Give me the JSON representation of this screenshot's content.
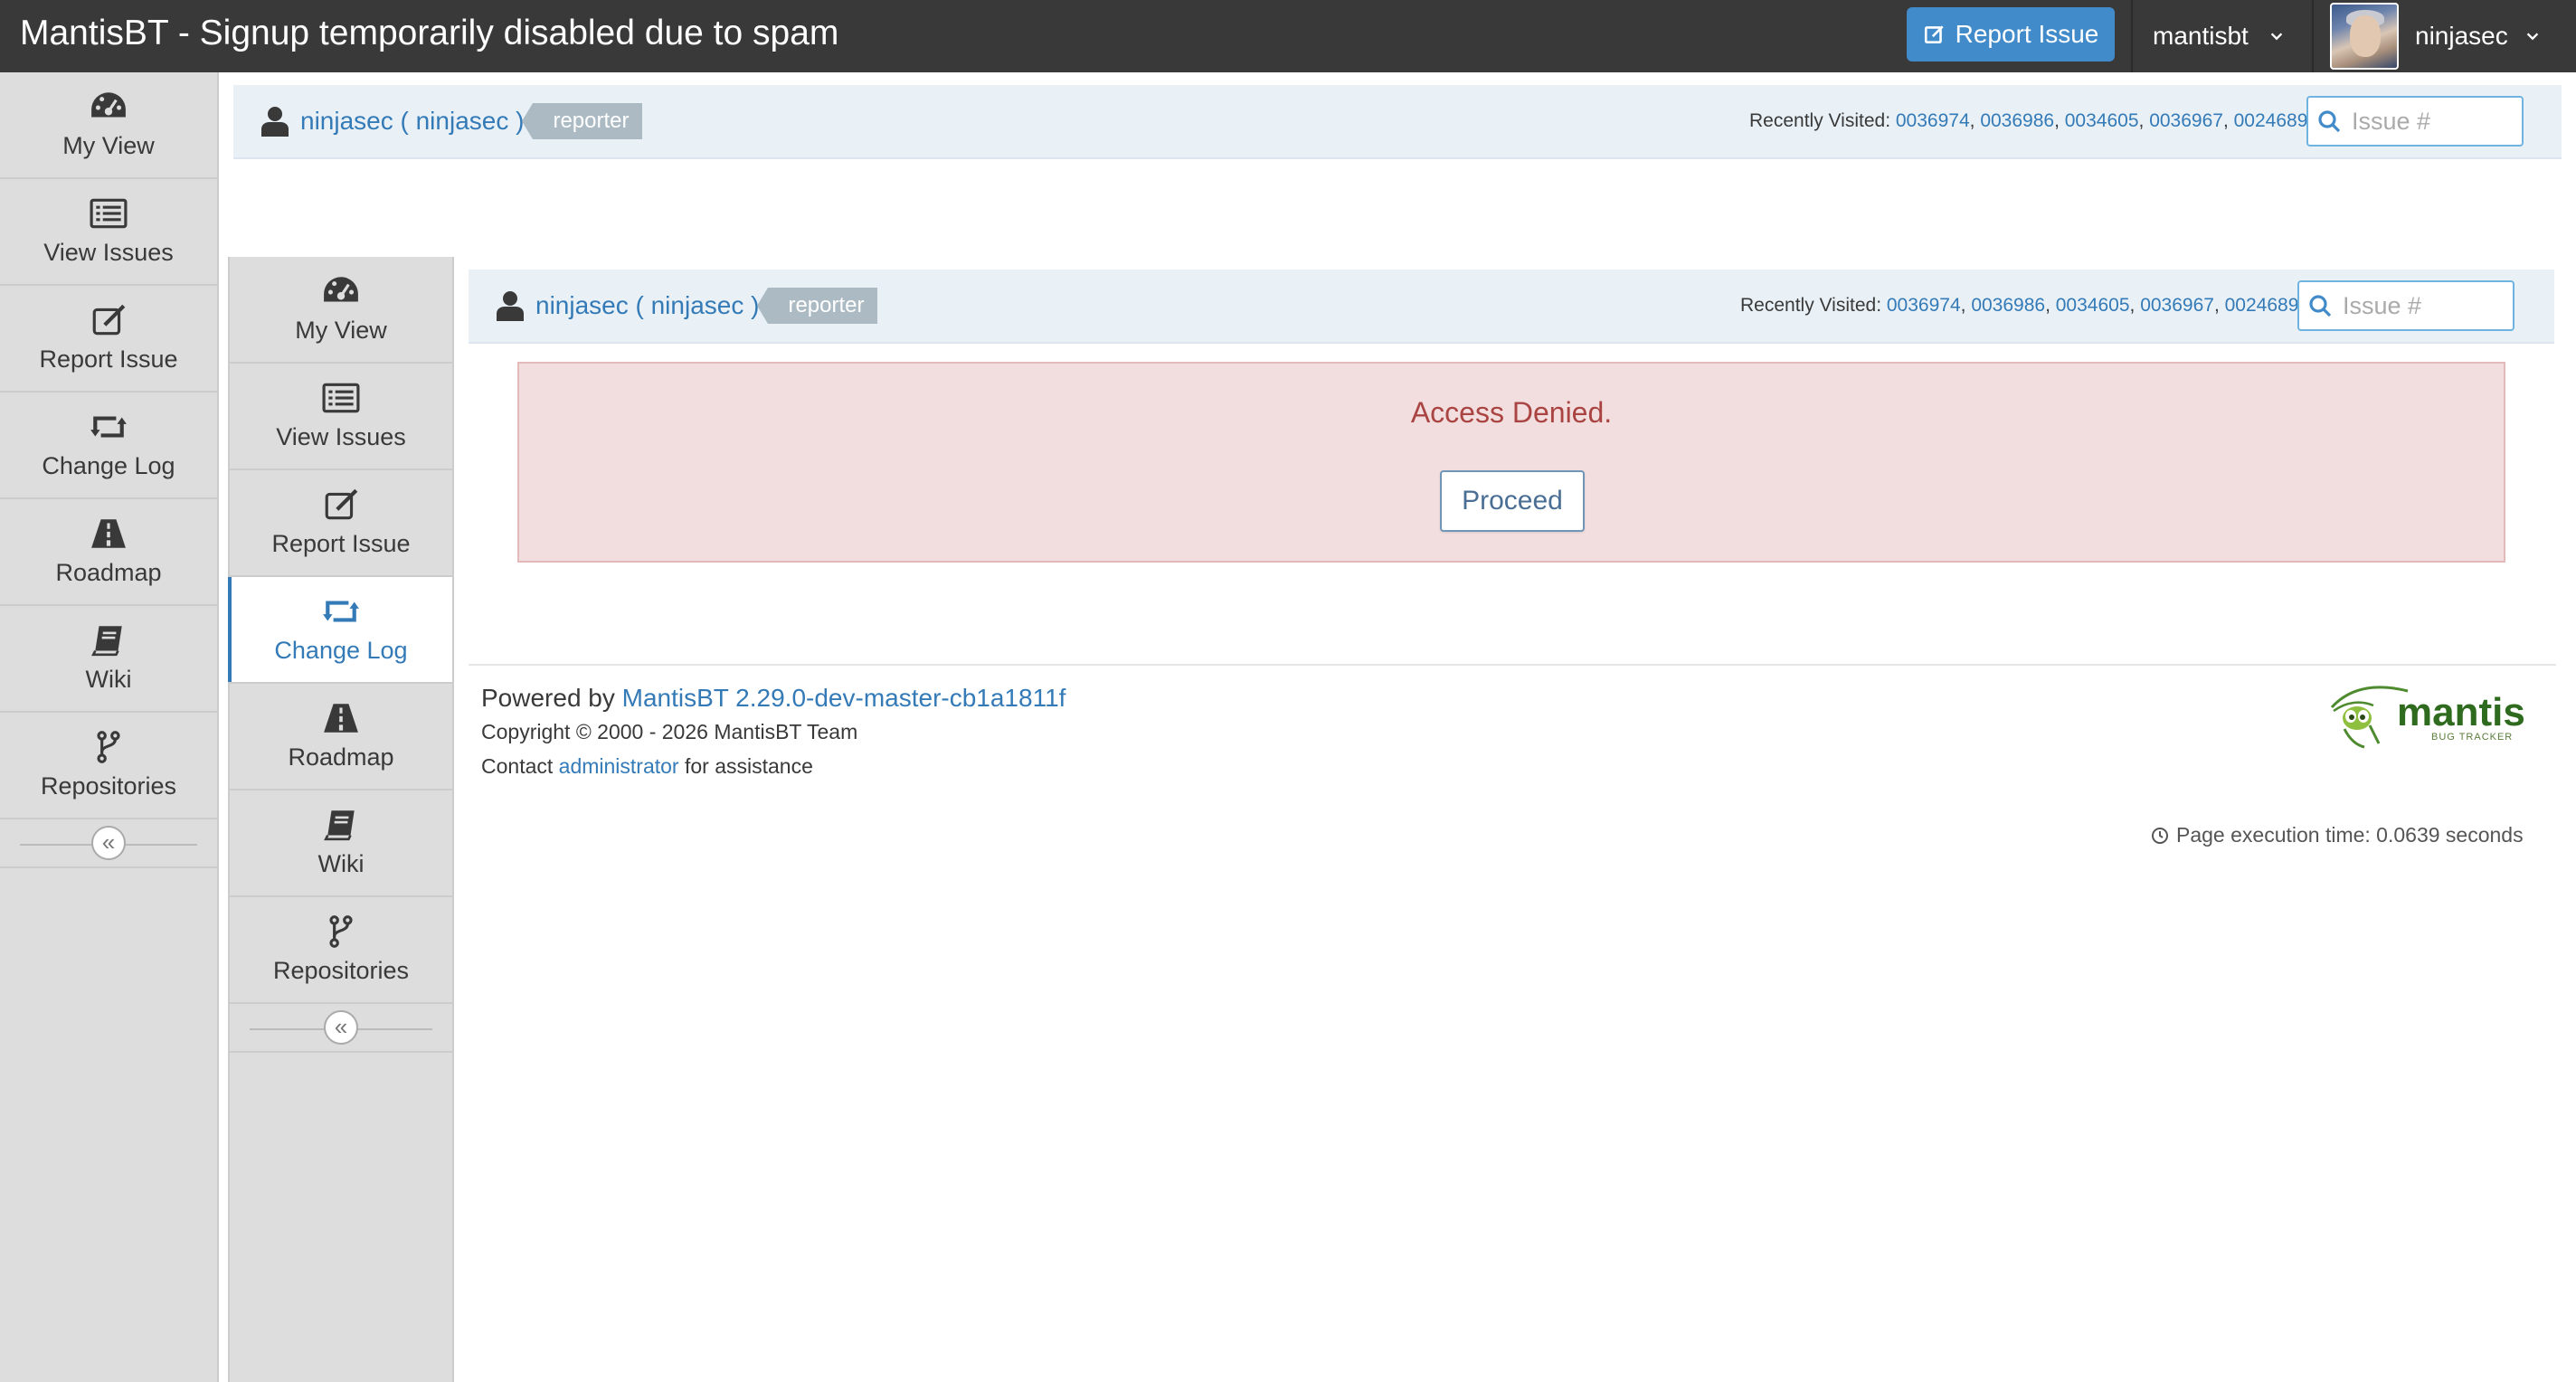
{
  "navbar": {
    "title": "MantisBT - Signup temporarily disabled due to spam",
    "report_label": "Report Issue",
    "project_label": "mantisbt",
    "user_label": "ninjasec"
  },
  "sidebar": {
    "items": [
      {
        "label": "My View",
        "icon": "dashboard-icon"
      },
      {
        "label": "View Issues",
        "icon": "list-icon"
      },
      {
        "label": "Report Issue",
        "icon": "edit-icon"
      },
      {
        "label": "Change Log",
        "icon": "retweet-icon"
      },
      {
        "label": "Roadmap",
        "icon": "road-icon"
      },
      {
        "label": "Wiki",
        "icon": "book-icon"
      },
      {
        "label": "Repositories",
        "icon": "code-fork-icon"
      }
    ],
    "active_inner": "Change Log",
    "collapse_glyph": "«"
  },
  "breadcrumb": {
    "user_text": "ninjasec ( ninjasec )",
    "role": "reporter",
    "recent_label": "Recently Visited:",
    "recent_ids": [
      "0036974",
      "0036986",
      "0034605",
      "0036967",
      "0024689"
    ],
    "search_placeholder": "Issue #"
  },
  "alert": {
    "message": "Access Denied.",
    "button_label": "Proceed"
  },
  "footer": {
    "powered_prefix": "Powered by",
    "powered_link": "MantisBT 2.29.0-dev-master-cb1a1811f",
    "copyright": "Copyright © 2000 - 2026 MantisBT Team",
    "contact_prefix": "Contact",
    "contact_link": "administrator",
    "contact_suffix": "for assistance",
    "logo_text": "mantis",
    "logo_subtext": "BUG TRACKER",
    "exec_time": "Page execution time: 0.0639 seconds"
  },
  "colors": {
    "navbar_bg": "#393939",
    "accent": "#428bca",
    "link": "#337ab7",
    "alert_bg": "#f2dede",
    "alert_text": "#a94442",
    "sidebar_bg": "#dddddd",
    "breadcrumb_bg": "#e9f1f7",
    "badge_bg": "#abbac3"
  }
}
